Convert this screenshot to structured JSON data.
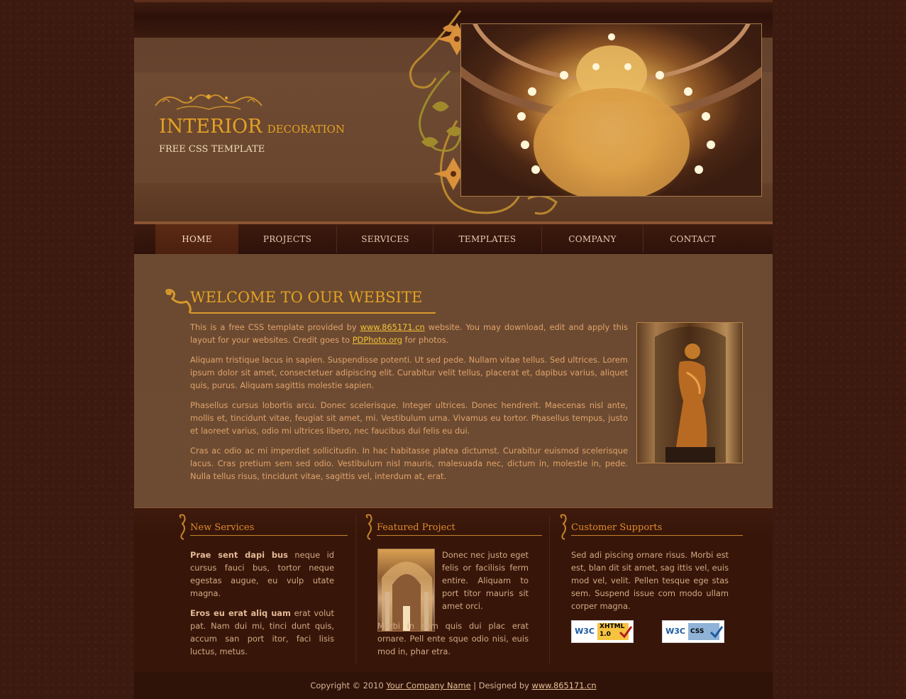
{
  "header": {
    "title_big": "INTERIOR",
    "title_small": "DECORATION",
    "subtitle": "FREE CSS TEMPLATE"
  },
  "nav": {
    "items": [
      {
        "label": "HOME",
        "active": true
      },
      {
        "label": "PROJECTS",
        "active": false
      },
      {
        "label": "SERVICES",
        "active": false
      },
      {
        "label": "TEMPLATES",
        "active": false
      },
      {
        "label": "COMPANY",
        "active": false
      },
      {
        "label": "CONTACT",
        "active": false
      }
    ]
  },
  "welcome": {
    "title": "WELCOME TO OUR WEBSITE",
    "p1_prefix": "This is a free CSS template provided by ",
    "p1_link1": "www.865171.cn",
    "p1_mid": " website. You may download, edit and apply this layout for your websites. Credit goes to ",
    "p1_link2": "PDPhoto.org",
    "p1_suffix": " for photos.",
    "p2": "Aliquam tristique lacus in sapien. Suspendisse potenti. Ut sed pede. Nullam vitae tellus. Sed ultrices. Lorem ipsum dolor sit amet, consectetuer adipiscing elit. Curabitur velit tellus, placerat et, dapibus varius, aliquet quis, purus. Aliquam sagittis molestie sapien.",
    "p3": "Phasellus cursus lobortis arcu. Donec scelerisque. Integer ultrices. Donec hendrerit. Maecenas nisl ante, mollis et, tincidunt vitae, feugiat sit amet, mi. Vestibulum urna. Vivamus eu tortor. Phasellus tempus, justo et laoreet varius, odio mi ultrices libero, nec faucibus dui felis eu dui.",
    "p4": "Cras ac odio ac mi imperdiet sollicitudin. In hac habitasse platea dictumst. Curabitur euismod scelerisque lacus. Cras pretium sem sed odio. Vestibulum nisl mauris, malesuada nec, dictum in, molestie in, pede. Nulla tellus risus, tincidunt vitae, sagittis vel, interdum at, erat."
  },
  "services": {
    "title": "New Services",
    "p1_bold": "Prae sent dapi bus",
    "p1_rest": " neque id cursus fauci bus, tortor neque egestas augue, eu vulp utate magna.",
    "p2_bold": "Eros eu erat aliq uam",
    "p2_rest": " erat volut pat. Nam dui mi, tinci dunt quis, accum san port itor, faci lisis luctus, metus."
  },
  "featured": {
    "title": "Featured Project",
    "text1": "Donec nec justo eget felis or facilisis ferm entire. Aliquam to port titor mauris sit amet orci.",
    "text2": "Morbi in sem quis dui plac erat ornare. Pell ente sque odio nisi, euis mod in, phar etra."
  },
  "support": {
    "title": "Customer Supports",
    "text": "Sed adi piscing ornare risus. Morbi est est, blan dit sit amet, sag ittis vel, euis mod vel, velit. Pellen tesque ege stas sem. Suspend issue com modo ullam corper magna.",
    "badge1_w3c": "W3C",
    "badge1_label": "XHTML",
    "badge1_version": "1.0",
    "badge2_w3c": "W3C",
    "badge2_label": "CSS"
  },
  "footer": {
    "prefix": "Copyright © 2010 ",
    "company_link": "Your Company Name",
    "mid": " | Designed by ",
    "designer_link": "www.865171.cn"
  },
  "colors": {
    "accent_gold": "#e3a224",
    "body_text": "#e0a36b",
    "link": "#f3c238"
  }
}
